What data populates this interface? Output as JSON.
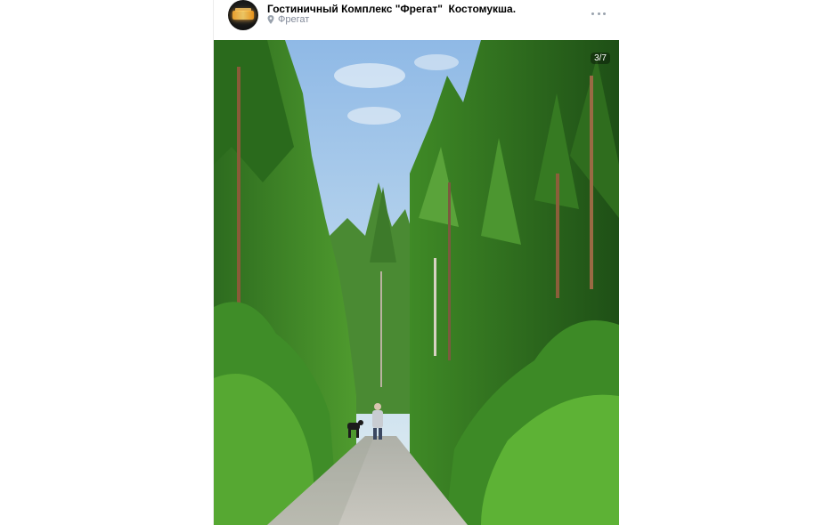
{
  "post": {
    "author": "Гостиничный Комплекс \"Фрегат\"  Костомукша.",
    "location": "Фрегат",
    "photo_counter": "3/7"
  },
  "icons": {
    "location": "map-pin-icon",
    "more": "more-horizontal-icon"
  },
  "colors": {
    "meta_text": "#828a99",
    "title_text": "#000000"
  }
}
